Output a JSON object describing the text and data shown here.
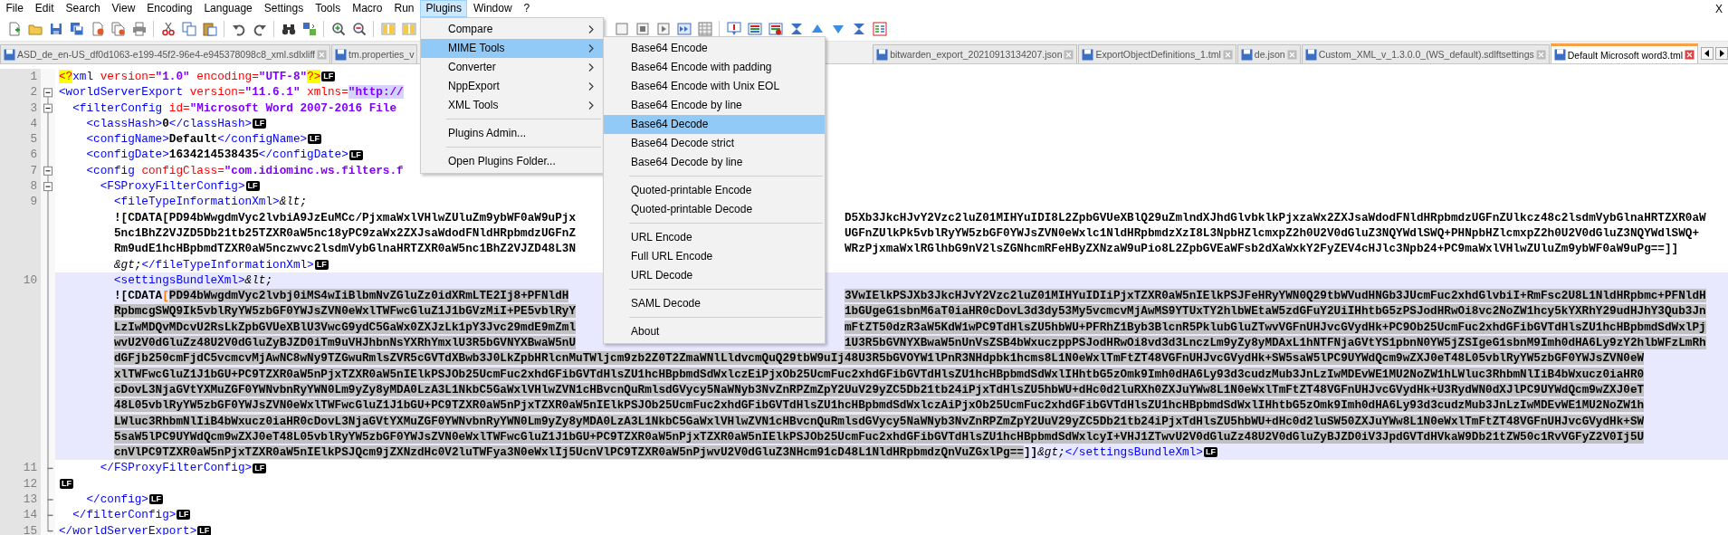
{
  "menu_bar": [
    {
      "label": "File",
      "selected": false
    },
    {
      "label": "Edit",
      "selected": false
    },
    {
      "label": "Search",
      "selected": false
    },
    {
      "label": "View",
      "selected": false
    },
    {
      "label": "Encoding",
      "selected": false
    },
    {
      "label": "Language",
      "selected": false
    },
    {
      "label": "Settings",
      "selected": false
    },
    {
      "label": "Tools",
      "selected": false
    },
    {
      "label": "Macro",
      "selected": false
    },
    {
      "label": "Run",
      "selected": false
    },
    {
      "label": "Plugins",
      "selected": true
    },
    {
      "label": "Window",
      "selected": false
    },
    {
      "label": "?",
      "selected": false
    }
  ],
  "close_document": "X",
  "plugins_menu": [
    {
      "kind": "submenu",
      "label": "Compare",
      "selected": false
    },
    {
      "kind": "submenu",
      "label": "MIME Tools",
      "selected": true
    },
    {
      "kind": "submenu",
      "label": "Converter",
      "selected": false
    },
    {
      "kind": "submenu",
      "label": "NppExport",
      "selected": false
    },
    {
      "kind": "submenu",
      "label": "XML Tools",
      "selected": false
    },
    {
      "kind": "separator"
    },
    {
      "kind": "item",
      "label": "Plugins Admin...",
      "selected": false
    },
    {
      "kind": "separator"
    },
    {
      "kind": "item",
      "label": "Open Plugins Folder...",
      "selected": false
    }
  ],
  "mime_tools_menu": [
    {
      "kind": "item",
      "label": "Base64 Encode",
      "selected": false
    },
    {
      "kind": "item",
      "label": "Base64 Encode with padding",
      "selected": false
    },
    {
      "kind": "item",
      "label": "Base64 Encode with Unix EOL",
      "selected": false
    },
    {
      "kind": "item",
      "label": "Base64 Encode by line",
      "selected": false
    },
    {
      "kind": "item",
      "label": "Base64 Decode",
      "selected": true
    },
    {
      "kind": "item",
      "label": "Base64 Decode strict",
      "selected": false
    },
    {
      "kind": "item",
      "label": "Base64 Decode by line",
      "selected": false
    },
    {
      "kind": "separator"
    },
    {
      "kind": "item",
      "label": "Quoted-printable Encode",
      "selected": false
    },
    {
      "kind": "item",
      "label": "Quoted-printable Decode",
      "selected": false
    },
    {
      "kind": "separator"
    },
    {
      "kind": "item",
      "label": "URL Encode",
      "selected": false
    },
    {
      "kind": "item",
      "label": "Full URL Encode",
      "selected": false
    },
    {
      "kind": "item",
      "label": "URL Decode",
      "selected": false
    },
    {
      "kind": "separator"
    },
    {
      "kind": "item",
      "label": "SAML Decode",
      "selected": false
    },
    {
      "kind": "separator"
    },
    {
      "kind": "item",
      "label": "About",
      "selected": false
    }
  ],
  "tabs_left": [
    {
      "label": "ASD_de_en-US_df0d1063-e199-45f2-96e4-e945378098c8_xml.sdlxliff",
      "selected": false
    },
    {
      "label": "tm.properties_v",
      "selected": false
    }
  ],
  "tabs_right": [
    {
      "label": "bitwarden_export_20210913134207.json",
      "selected": false
    },
    {
      "label": "ExportObjectDefinitions_1.tml",
      "selected": false
    },
    {
      "label": "de.json",
      "selected": false
    },
    {
      "label": "Custom_XML_v_1.3.0.0_(WS_default).sdlftsettings",
      "selected": false
    },
    {
      "label": "Default Microsoft word3.tml",
      "selected": true
    }
  ],
  "editor": {
    "lines": [
      {
        "number": "1",
        "current": false,
        "foldable": false,
        "block_end": false,
        "rows": [
          {
            "segs": [
              {
                "kind": "decl",
                "text": "<?"
              },
              {
                "kind": "tag",
                "text": "xml"
              },
              {
                "kind": "attr",
                "text": " version="
              },
              {
                "kind": "value",
                "text": "\"1.0\""
              },
              {
                "kind": "attr",
                "text": " encoding="
              },
              {
                "kind": "value",
                "text": "\"UTF-8\""
              },
              {
                "kind": "decl",
                "text": "?>"
              }
            ],
            "eol": "LF"
          }
        ]
      },
      {
        "number": "2",
        "current": false,
        "foldable": true,
        "block_end": false,
        "rows": [
          {
            "segs": [
              {
                "kind": "tag",
                "text": "<worldServerExport"
              },
              {
                "kind": "attr",
                "text": " version="
              },
              {
                "kind": "value",
                "text": "\"11.6.1\""
              },
              {
                "kind": "attr",
                "text": " xmlns="
              },
              {
                "kind": "mark",
                "text": "\"http://"
              }
            ]
          }
        ]
      },
      {
        "number": "3",
        "current": false,
        "foldable": true,
        "block_end": false,
        "rows": [
          {
            "segs": [
              {
                "kind": "tag",
                "text": "  <filterConfig"
              },
              {
                "kind": "attr",
                "text": " id="
              },
              {
                "kind": "value",
                "text": "\"Microsoft Word 2007-2016 File"
              }
            ]
          }
        ]
      },
      {
        "number": "4",
        "current": false,
        "foldable": false,
        "block_end": false,
        "rows": [
          {
            "segs": [
              {
                "kind": "tag",
                "text": "    <classHash>"
              },
              {
                "kind": "text",
                "text": "0"
              },
              {
                "kind": "tag",
                "text": "</classHash>"
              }
            ],
            "eol": "LF"
          }
        ]
      },
      {
        "number": "5",
        "current": false,
        "foldable": false,
        "block_end": false,
        "rows": [
          {
            "segs": [
              {
                "kind": "tag",
                "text": "    <configName>"
              },
              {
                "kind": "text",
                "text": "Default"
              },
              {
                "kind": "tag",
                "text": "</configName>"
              }
            ],
            "eol": "LF"
          }
        ]
      },
      {
        "number": "6",
        "current": false,
        "foldable": false,
        "block_end": false,
        "rows": [
          {
            "segs": [
              {
                "kind": "tag",
                "text": "    <configDate>"
              },
              {
                "kind": "text",
                "text": "1634214538435"
              },
              {
                "kind": "tag",
                "text": "</configDate>"
              }
            ],
            "eol": "LF"
          }
        ]
      },
      {
        "number": "7",
        "current": false,
        "foldable": true,
        "block_end": false,
        "rows": [
          {
            "segs": [
              {
                "kind": "tag",
                "text": "    <config"
              },
              {
                "kind": "attr",
                "text": " configClass="
              },
              {
                "kind": "value",
                "text": "\"com.idiominc.ws.filters.f"
              }
            ]
          }
        ]
      },
      {
        "number": "8",
        "current": false,
        "foldable": true,
        "block_end": false,
        "rows": [
          {
            "segs": [
              {
                "kind": "tag",
                "text": "      <FSProxyFilterConfig>"
              }
            ],
            "eol": "LF"
          }
        ]
      },
      {
        "number": "9",
        "current": false,
        "foldable": false,
        "block_end": false,
        "rows": [
          {
            "segs": [
              {
                "kind": "tag",
                "text": "        <fileTypeInformationXml>"
              },
              {
                "kind": "entity",
                "text": "&lt;"
              }
            ]
          },
          {
            "continued": true,
            "segs": [
              {
                "kind": "text",
                "text": "![CDATA[PD94bWwgdmVyc2lvbiA9JzEuMCc/PjxmaWxlVHlwZUluZm9ybWF0aW9uPjx"
              }
            ],
            "after": [
              {
                "kind": "text",
                "text": "D5Xb3JkcHJvY2Vzc2luZ01MIHYuIDI8L2ZpbGVUeXBlQ29uZmlndXJhdGlvbklkPjxzaWx2ZXJsaWdodFNldHRpbmdzUGFnZUlkcz48c2lsdmVybGlnaHRTZXR0aW"
              }
            ]
          },
          {
            "continued": true,
            "segs": [
              {
                "kind": "text",
                "text": "5nc1BhZ2VJZD5Db21tb25TZXR0aW5nc18yPC9zaWx2ZXJsaWdodFNldHRpbmdzUGFnZ"
              }
            ],
            "after": [
              {
                "kind": "text",
                "text": "UGFnZUlkPk5vblRyYW5zbGF0YWJsZVN0eWxlc1NldHRpbmdzXzI8L3NpbHZlcmxpZ2h0U2V0dGluZ3NQYWdlSWQ+PHNpbHZlcmxpZ2h0U2V0dGluZ3NQYWdlSWQ+"
              }
            ]
          },
          {
            "continued": true,
            "segs": [
              {
                "kind": "text",
                "text": "Rm9udE1hcHBpbmdTZXR0aW5nczwvc2lsdmVybGlnaHRTZXR0aW5nc1BhZ2VJZD48L3N"
              }
            ],
            "after": [
              {
                "kind": "text",
                "text": "WRzPjxmaWxlRGlhbG9nV2lsZGNhcmRFeHByZXNzaW9uPio8L2ZpbGVEaWFsb2dXaWxkY2FyZEV4cHJlc3Npb24+PC9maWxlVHlwZUluZm9ybWF0aW9uPg==]]"
              }
            ]
          },
          {
            "continued": true,
            "segs": [
              {
                "kind": "entity",
                "text": "&gt;"
              },
              {
                "kind": "tag",
                "text": "</fileTypeInformationXml>"
              }
            ],
            "eol": "LF"
          }
        ]
      },
      {
        "number": "10",
        "current": true,
        "foldable": false,
        "block_end": false,
        "rows": [
          {
            "segs": [
              {
                "kind": "tag",
                "text": "        <settingsBundleXml>"
              },
              {
                "kind": "entity",
                "text": "&lt;"
              }
            ]
          },
          {
            "continued": true,
            "segs": [
              {
                "kind": "text",
                "text": "![CDATA"
              },
              {
                "kind": "brace",
                "text": "["
              },
              {
                "kind": "sel",
                "text": "PD94bWwgdmVyc2lvbj0iMS4wIiBlbmNvZGluZz0idXRmLTE2Ij8+PFNldH"
              }
            ],
            "after": [
              {
                "kind": "sel",
                "text": "3VwIElkPSJXb3JkcHJvY2Vzc2luZ01MIHYuIDIiPjxTZXR0aW5nIElkPSJFeHRyYWN0Q29tbWVudHNGb3JUcmFuc2xhdGlvbiI+RmFsc2U8L1NldHRpbmc+PFNldH"
              }
            ]
          },
          {
            "continued": true,
            "segs": [
              {
                "kind": "sel",
                "text": "RpbmcgSWQ9Ik5vblRyYW5zbGF0YWJsZVN0eWxlTWFwcGluZ1J1bGVzMiI+PE5vblRyY"
              }
            ],
            "after": [
              {
                "kind": "sel",
                "text": "1bGUgeG1sbnM6aT0iaHR0cDovL3d3dy53My5vcmcvMjAwMS9YTUxTY2hlbWEtaW5zdGFuY2UiIHhtbG5zPSJodHRwOi8vc2NoZW1hcy5kYXRhY29udHJhY3Qub3Jn"
              }
            ]
          },
          {
            "continued": true,
            "segs": [
              {
                "kind": "sel",
                "text": "LzIwMDQvMDcvU2RsLkZpbGVUeXBlU3VwcG9ydC5GaWx0ZXJzLk1pY3Jvc29mdE9mZml"
              }
            ],
            "after": [
              {
                "kind": "sel",
                "text": "mFtZT50dzR3aW5KdW1wPC9TdHlsZU5hbWU+PFRhZ1Byb3BlcnR5PklubGluZTwvVGFnUHJvcGVydHk+PC9Ob25UcmFuc2xhdGFibGVTdHlsZU1hcHBpbmdSdWxlPj"
              }
            ]
          },
          {
            "continued": true,
            "segs": [
              {
                "kind": "sel",
                "text": "wvU2V0dGluZz48U2V0dGluZyBJZD0iTm9uVHJhbnNsYXRhYmxlU3R5bGVNYXBwaW5nU"
              }
            ],
            "after": [
              {
                "kind": "sel",
                "text": "1U3R5bGVNYXBwaW5nUnVsZSB4bWxuczppPSJodHRwOi8vd3d3LnczLm9yZy8yMDAxL1hNTFNjaGVtYS1pbnN0YW5jZSIgeG1sbnM9Imh0dHA6Ly9zY2hlbWFzLmRh"
              }
            ]
          },
          {
            "continued": true,
            "segs": [
              {
                "kind": "sel",
                "text": "dGFjb250cmFjdC5vcmcvMjAwNC8wNy9TZGwuRmlsZVR5cGVTdXBwb3J0LkZpbHRlcnMuTWljcm9zb2Z0T2ZmaWNlLldvcmQuQ29tbW9uIj48U3R5bGVOYW1lPnR3NHdpbk1hcms8L1N0eWxlTmFtZT48VGFnUHJvcGVydHk+SW5saW5lPC9UYWdQcm9wZXJ0eT48L05vblRyYW5zbGF0YWJsZVN0eW"
              }
            ]
          },
          {
            "continued": true,
            "segs": [
              {
                "kind": "sel",
                "text": "xlTWFwcGluZ1J1bGU+PC9TZXR0aW5nPjxTZXR0aW5nIElkPSJOb25UcmFuc2xhdGFibGVTdHlsZU1hcHBpbmdSdWxlczEiPjxOb25UcmFuc2xhdGFibGVTdHlsZU1hcHBpbmdSdWxlIHhtbG5zOmk9Imh0dHA6Ly93d3cudzMub3JnLzIwMDEvWE1MU2NoZW1hLWluc3RhbmNlIiB4bWxucz0iaHR0"
              }
            ]
          },
          {
            "continued": true,
            "segs": [
              {
                "kind": "sel",
                "text": "cDovL3NjaGVtYXMuZGF0YWNvbnRyYWN0Lm9yZy8yMDA0LzA3L1NkbC5GaWxlVHlwZVN1cHBvcnQuRmlsdGVycy5NaWNyb3NvZnRPZmZpY2UuV29yZC5Db21tb24iPjxTdHlsZU5hbWU+dHc0d2luRXh0ZXJuYWw8L1N0eWxlTmFtZT48VGFnUHJvcGVydHk+U3RydWN0dXJlPC9UYWdQcm9wZXJ0eT"
              }
            ]
          },
          {
            "continued": true,
            "segs": [
              {
                "kind": "sel",
                "text": "48L05vblRyYW5zbGF0YWJsZVN0eWxlTWFwcGluZ1J1bGU+PC9TZXR0aW5nPjxTZXR0aW5nIElkPSJOb25UcmFuc2xhdGFibGVTdHlsZU1hcHBpbmdSdWxlczAiPjxOb25UcmFuc2xhdGFibGVTdHlsZU1hcHBpbmdSdWxlIHhtbG5zOmk9Imh0dHA6Ly93d3cudzMub3JnLzIwMDEvWE1MU2NoZW1h"
              }
            ]
          },
          {
            "continued": true,
            "segs": [
              {
                "kind": "sel",
                "text": "LWluc3RhbmNlIiB4bWxucz0iaHR0cDovL3NjaGVtYXMuZGF0YWNvbnRyYWN0Lm9yZy8yMDA0LzA3L1NkbC5GaWxlVHlwZVN1cHBvcnQuRmlsdGVycy5NaWNyb3NvZnRPZmZpY2UuV29yZC5Db21tb24iPjxTdHlsZU5hbWU+dHc0d2luSW50ZXJuYWw8L1N0eWxlTmFtZT48VGFnUHJvcGVydHk+SW"
              }
            ]
          },
          {
            "continued": true,
            "segs": [
              {
                "kind": "sel",
                "text": "5saW5lPC9UYWdQcm9wZXJ0eT48L05vblRyYW5zbGF0YWJsZVN0eWxlTWFwcGluZ1J1bGU+PC9TZXR0aW5nPjxTZXR0aW5nIElkPSJOb25UcmFuc2xhdGFibGVTdHlsZU1hcHBpbmdSdWxlcyI+VHJ1ZTwvU2V0dGluZz48U2V0dGluZyBJZD0iV3JpdGVTdHVkaW9Db21tZW50c1RvVGFyZ2V0Ij5U"
              }
            ]
          },
          {
            "continued": true,
            "segs": [
              {
                "kind": "sel",
                "text": "cnVlPC9TZXR0aW5nPjxTZXR0aW5nIElkPSJQcm9jZXNzdHc0V2luTWFya3N0eWxlIj5UcnVlPC9TZXR0aW5nPjwvU2V0dGluZ3NHcm91cD48L1NldHRpbmdzQnVuZGxlPg=="
              },
              {
                "kind": "text",
                "text": "]]"
              },
              {
                "kind": "entity",
                "text": "&gt;"
              },
              {
                "kind": "tag",
                "text": "</settingsBundleXml>"
              }
            ],
            "eol": "LF"
          }
        ]
      },
      {
        "number": "11",
        "current": false,
        "foldable": false,
        "block_end": true,
        "rows": [
          {
            "segs": [
              {
                "kind": "tag",
                "text": "      </FSProxyFilterConfig>"
              }
            ],
            "eol": "LF"
          }
        ]
      },
      {
        "number": "12",
        "current": false,
        "foldable": false,
        "block_end": false,
        "rows": [
          {
            "segs": [],
            "eol": "LF"
          }
        ]
      },
      {
        "number": "13",
        "current": false,
        "foldable": false,
        "block_end": true,
        "rows": [
          {
            "segs": [
              {
                "kind": "tag",
                "text": "    </config>"
              }
            ],
            "eol": "LF"
          }
        ]
      },
      {
        "number": "14",
        "current": false,
        "foldable": false,
        "block_end": true,
        "rows": [
          {
            "segs": [
              {
                "kind": "tag",
                "text": "  </filterConfig>"
              }
            ],
            "eol": "LF"
          }
        ]
      },
      {
        "number": "15",
        "current": false,
        "foldable": false,
        "block_end": true,
        "rows": [
          {
            "segs": [
              {
                "kind": "tag",
                "text": "</worldServerExport>"
              }
            ],
            "eol": "LF"
          }
        ]
      }
    ]
  }
}
